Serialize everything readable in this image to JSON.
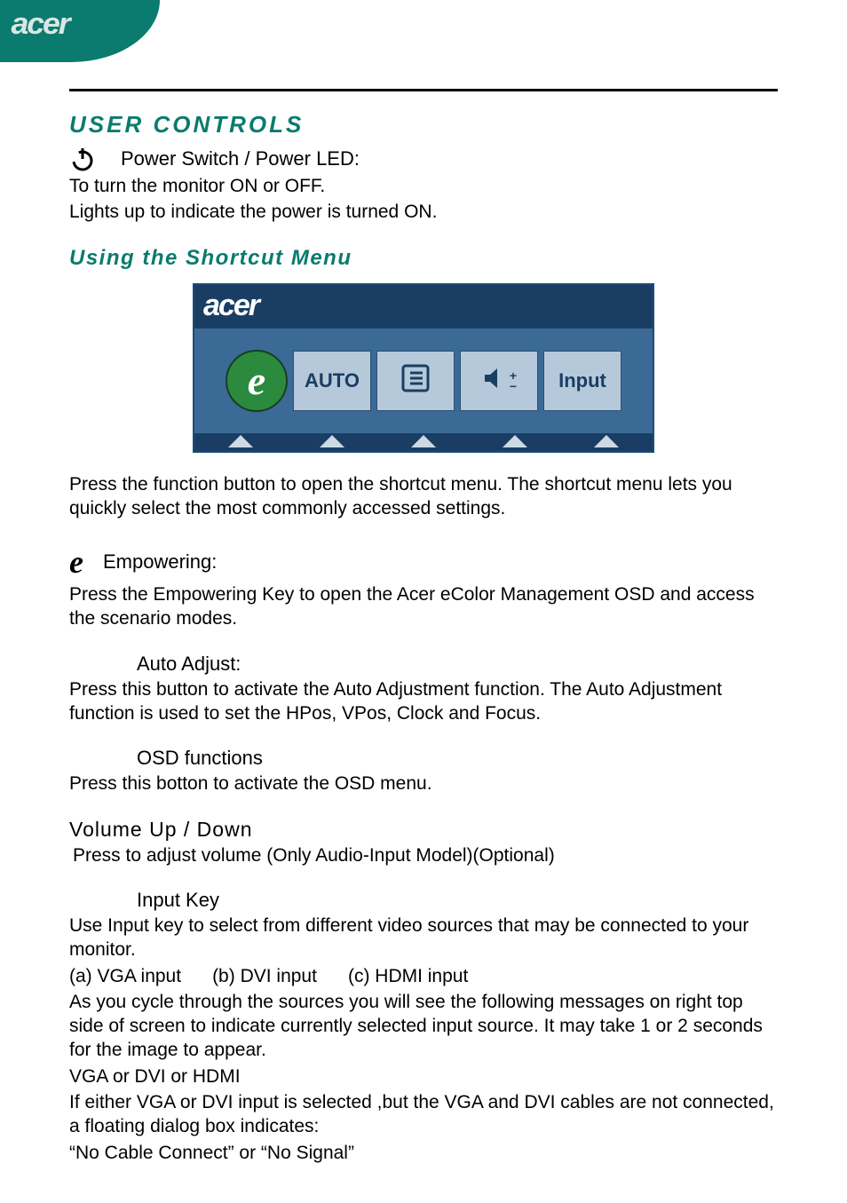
{
  "header": {
    "brand": "acer"
  },
  "section1": {
    "title": "USER CONTROLS",
    "power_label": "Power Switch / Power LED:",
    "power_line1": "To turn the monitor ON or OFF.",
    "power_line2": "Lights up to indicate the power is turned ON."
  },
  "shortcut": {
    "title": "Using   the  Shortcut  Menu",
    "osd_brand": "acer",
    "btn_auto": "AUTO",
    "btn_input": "Input",
    "desc": "Press the function button to open the shortcut menu. The shortcut menu lets you quickly select the most commonly accessed settings."
  },
  "empowering": {
    "label": "Empowering:",
    "desc": "Press the Empowering Key to open the Acer eColor Management OSD and access the scenario modes."
  },
  "auto": {
    "label": "Auto Adjust:",
    "desc": "Press this button to activate the Auto Adjustment function. The Auto Adjustment function is used to set the HPos, VPos, Clock and Focus."
  },
  "osdfn": {
    "label": "OSD functions",
    "desc": "Press this botton to activate the OSD menu."
  },
  "volume": {
    "label": "Volume  Up  /  Down",
    "desc": " Press to adjust volume (Only Audio-Input Model)(Optional)"
  },
  "inputkey": {
    "label": "Input Key",
    "l1": "Use Input key to select from different video sources that may be connected to your monitor.",
    "l2": "(a) VGA input      (b) DVI input      (c) HDMI input",
    "l3": "As you cycle through the sources you will see the following messages on right top side of screen to indicate currently selected input source. It may take 1 or 2 seconds for the image to appear.",
    "l4": "VGA   or  DVI  or  HDMI",
    "l5": "If either VGA or DVI input is selected ,but the VGA and DVI cables are not connected, a floating dialog box indicates:",
    "l6": "“No Cable Connect” or “No Signal”"
  }
}
